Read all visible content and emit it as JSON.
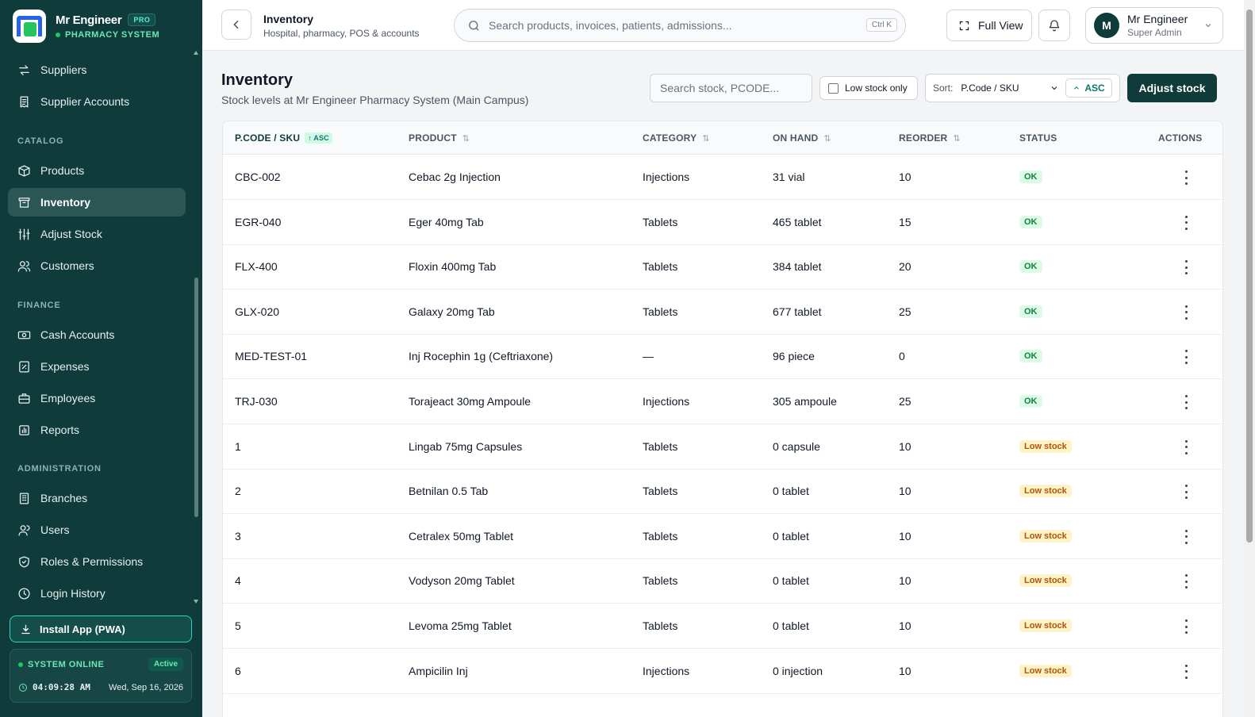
{
  "brand": {
    "name": "Mr Engineer",
    "badge": "PRO",
    "subtitle": "PHARMACY SYSTEM"
  },
  "sidebar": {
    "items_top": [
      {
        "label": "Suppliers",
        "icon": "arrows-swap-icon"
      },
      {
        "label": "Supplier Accounts",
        "icon": "receipt-icon"
      }
    ],
    "catalog_title": "CATALOG",
    "catalog": [
      {
        "label": "Products",
        "icon": "box-icon"
      },
      {
        "label": "Inventory",
        "icon": "archive-icon",
        "active": true
      },
      {
        "label": "Adjust Stock",
        "icon": "sliders-icon"
      },
      {
        "label": "Customers",
        "icon": "users-icon"
      }
    ],
    "finance_title": "FINANCE",
    "finance": [
      {
        "label": "Cash Accounts",
        "icon": "cash-icon"
      },
      {
        "label": "Expenses",
        "icon": "expense-icon"
      },
      {
        "label": "Employees",
        "icon": "briefcase-icon"
      },
      {
        "label": "Reports",
        "icon": "chart-icon"
      }
    ],
    "admin_title": "ADMINISTRATION",
    "admin": [
      {
        "label": "Branches",
        "icon": "building-icon"
      },
      {
        "label": "Users",
        "icon": "user-icon"
      },
      {
        "label": "Roles & Permissions",
        "icon": "shield-icon"
      },
      {
        "label": "Login History",
        "icon": "clock-icon"
      }
    ],
    "install_label": "Install App (PWA)",
    "system_status": "SYSTEM ONLINE",
    "system_badge": "Active",
    "time": "04:09:28 AM",
    "date": "Wed, Sep 16, 2026"
  },
  "topbar": {
    "title": "Inventory",
    "subtitle": "Hospital, pharmacy, POS & accounts",
    "search_placeholder": "Search products, invoices, patients, admissions...",
    "shortcut": "Ctrl K",
    "fullview_label": "Full View",
    "user_initial": "M",
    "user_name": "Mr Engineer",
    "user_role": "Super Admin"
  },
  "page": {
    "title": "Inventory",
    "subtitle": "Stock levels at Mr Engineer Pharmacy System (Main Campus)",
    "search_placeholder": "Search stock, PCODE...",
    "low_stock_label": "Low stock only",
    "sort_label": "Sort:",
    "sort_value": "P.Code / SKU",
    "sort_dir": "ASC",
    "adjust_label": "Adjust stock"
  },
  "table": {
    "headers": {
      "code": "P.CODE / SKU",
      "code_badge": "ASC",
      "product": "PRODUCT",
      "category": "CATEGORY",
      "onhand": "ON HAND",
      "reorder": "REORDER",
      "status": "STATUS",
      "actions": "ACTIONS"
    },
    "rows": [
      {
        "code": "CBC-002",
        "product": "Cebac 2g Injection",
        "category": "Injections",
        "onhand": "31 vial",
        "reorder": "10",
        "status": "OK"
      },
      {
        "code": "EGR-040",
        "product": "Eger 40mg Tab",
        "category": "Tablets",
        "onhand": "465 tablet",
        "reorder": "15",
        "status": "OK"
      },
      {
        "code": "FLX-400",
        "product": "Floxin 400mg Tab",
        "category": "Tablets",
        "onhand": "384 tablet",
        "reorder": "20",
        "status": "OK"
      },
      {
        "code": "GLX-020",
        "product": "Galaxy 20mg Tab",
        "category": "Tablets",
        "onhand": "677 tablet",
        "reorder": "25",
        "status": "OK"
      },
      {
        "code": "MED-TEST-01",
        "product": "Inj Rocephin 1g (Ceftriaxone)",
        "category": "—",
        "onhand": "96 piece",
        "reorder": "0",
        "status": "OK"
      },
      {
        "code": "TRJ-030",
        "product": "Torajeact 30mg Ampoule",
        "category": "Injections",
        "onhand": "305 ampoule",
        "reorder": "25",
        "status": "OK"
      },
      {
        "code": "1",
        "product": "Lingab 75mg Capsules",
        "category": "Tablets",
        "onhand": "0 capsule",
        "reorder": "10",
        "status": "Low stock"
      },
      {
        "code": "2",
        "product": "Betnilan 0.5 Tab",
        "category": "Tablets",
        "onhand": "0 tablet",
        "reorder": "10",
        "status": "Low stock"
      },
      {
        "code": "3",
        "product": "Cetralex 50mg Tablet",
        "category": "Tablets",
        "onhand": "0 tablet",
        "reorder": "10",
        "status": "Low stock"
      },
      {
        "code": "4",
        "product": "Vodyson 20mg Tablet",
        "category": "Tablets",
        "onhand": "0 tablet",
        "reorder": "10",
        "status": "Low stock"
      },
      {
        "code": "5",
        "product": "Levoma 25mg Tablet",
        "category": "Tablets",
        "onhand": "0 tablet",
        "reorder": "10",
        "status": "Low stock"
      },
      {
        "code": "6",
        "product": "Ampicilin Inj",
        "category": "Injections",
        "onhand": "0 injection",
        "reorder": "10",
        "status": "Low stock"
      }
    ]
  }
}
